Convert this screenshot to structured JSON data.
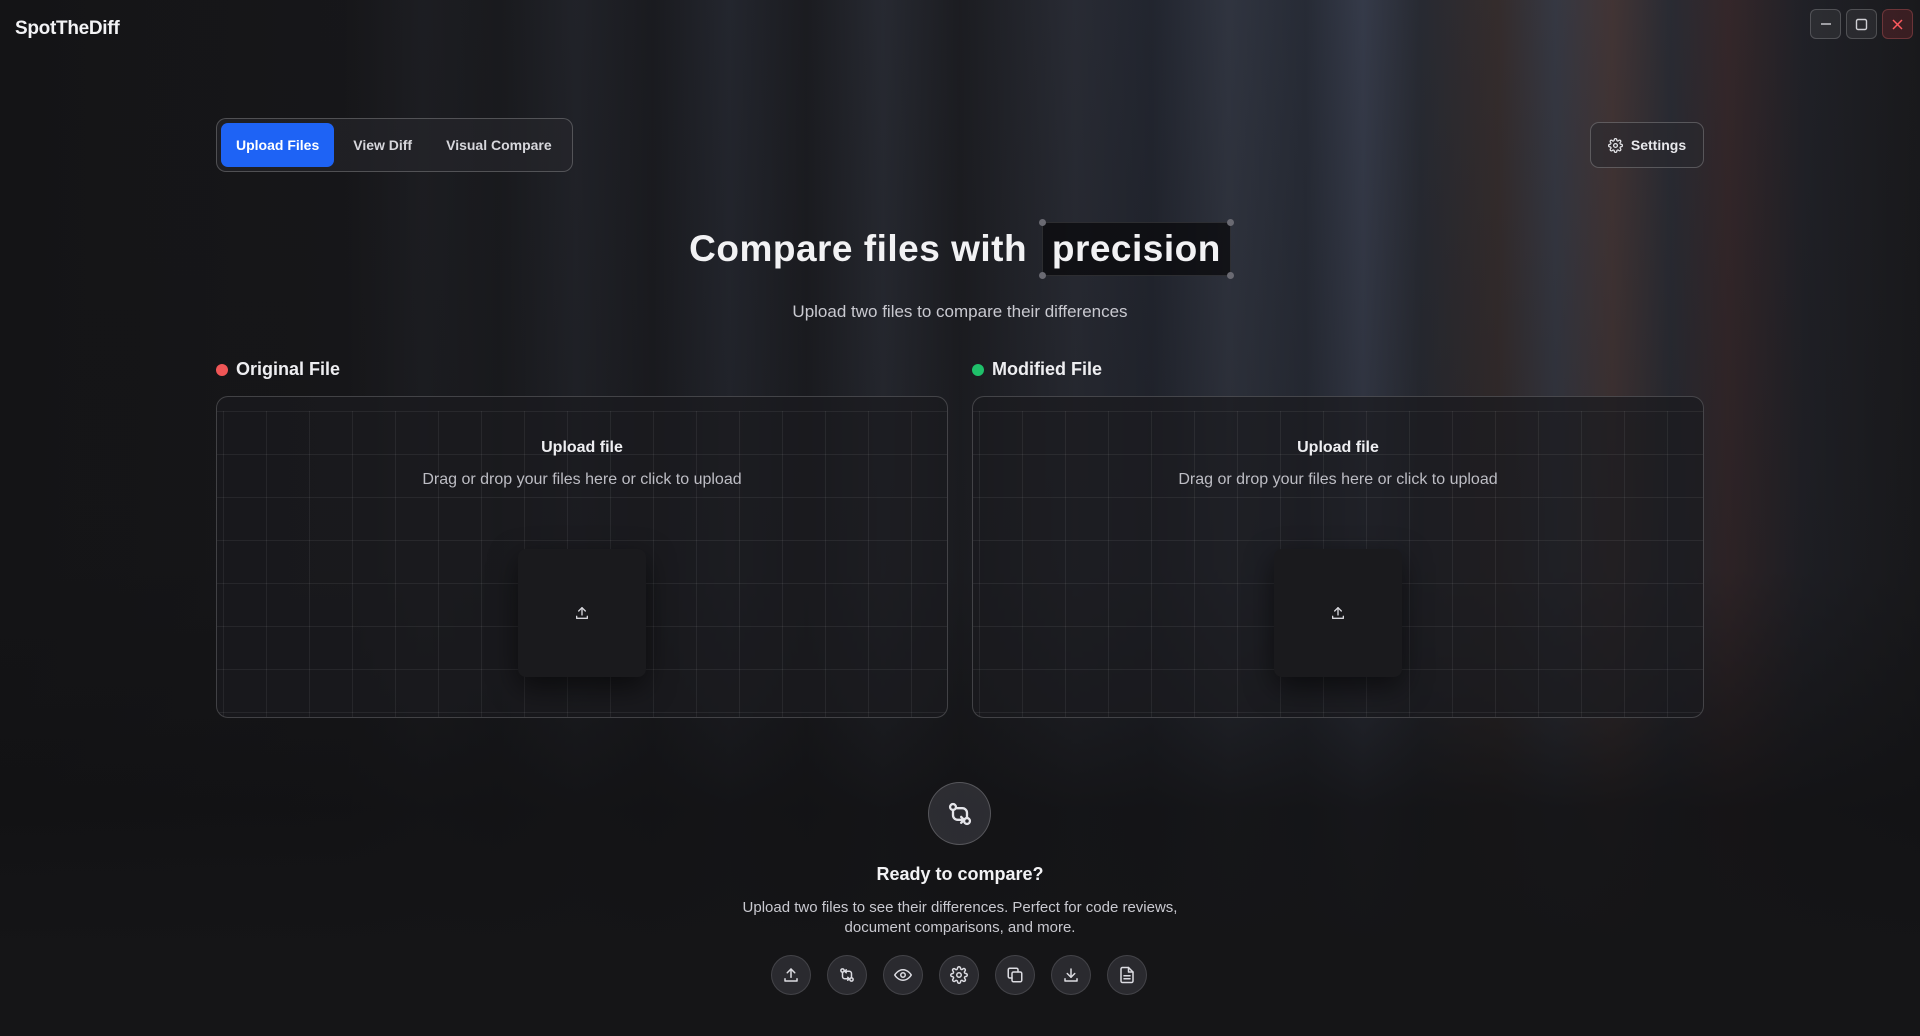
{
  "app": {
    "title": "SpotTheDiff"
  },
  "tabs": [
    {
      "label": "Upload Files",
      "active": true
    },
    {
      "label": "View Diff",
      "active": false
    },
    {
      "label": "Visual Compare",
      "active": false
    }
  ],
  "settings": {
    "label": "Settings"
  },
  "hero": {
    "title_prefix": "Compare files with",
    "title_highlight": "precision",
    "subtitle": "Upload two files to compare their differences"
  },
  "files": {
    "original": {
      "label": "Original File",
      "status_color": "#f05656",
      "upload_title": "Upload file",
      "upload_text": "Drag or drop your files here or click to upload"
    },
    "modified": {
      "label": "Modified File",
      "status_color": "#1fc06a",
      "upload_title": "Upload file",
      "upload_text": "Drag or drop your files here or click to upload"
    }
  },
  "ready": {
    "title": "Ready to compare?",
    "text": "Upload two files to see their differences. Perfect for code reviews, document comparisons, and more."
  },
  "toolbar_icons": [
    "upload-icon",
    "compare-icon",
    "eye-icon",
    "gear-icon",
    "copy-icon",
    "download-icon",
    "file-text-icon"
  ],
  "colors": {
    "accent": "#1e63f5"
  }
}
